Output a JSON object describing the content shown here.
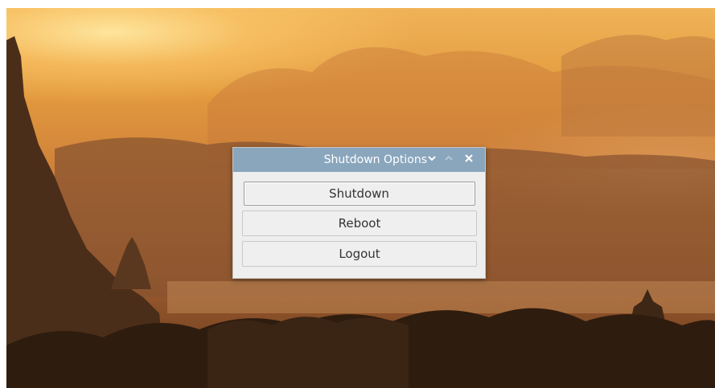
{
  "dialog": {
    "title": "Shutdown Options",
    "titlebar_color": "#8aa6bd",
    "buttons": [
      {
        "label": "Shutdown",
        "focused": true
      },
      {
        "label": "Reboot",
        "focused": false
      },
      {
        "label": "Logout",
        "focused": false
      }
    ],
    "window_controls": {
      "minimize_icon": "chevron-down-icon",
      "maximize_icon": "chevron-up-icon",
      "close_icon": "close-icon"
    }
  },
  "wallpaper": {
    "description_colors": {
      "sky": "#e39a3e",
      "glow": "#ffe8a0",
      "silhouette": "#3a2414"
    }
  }
}
